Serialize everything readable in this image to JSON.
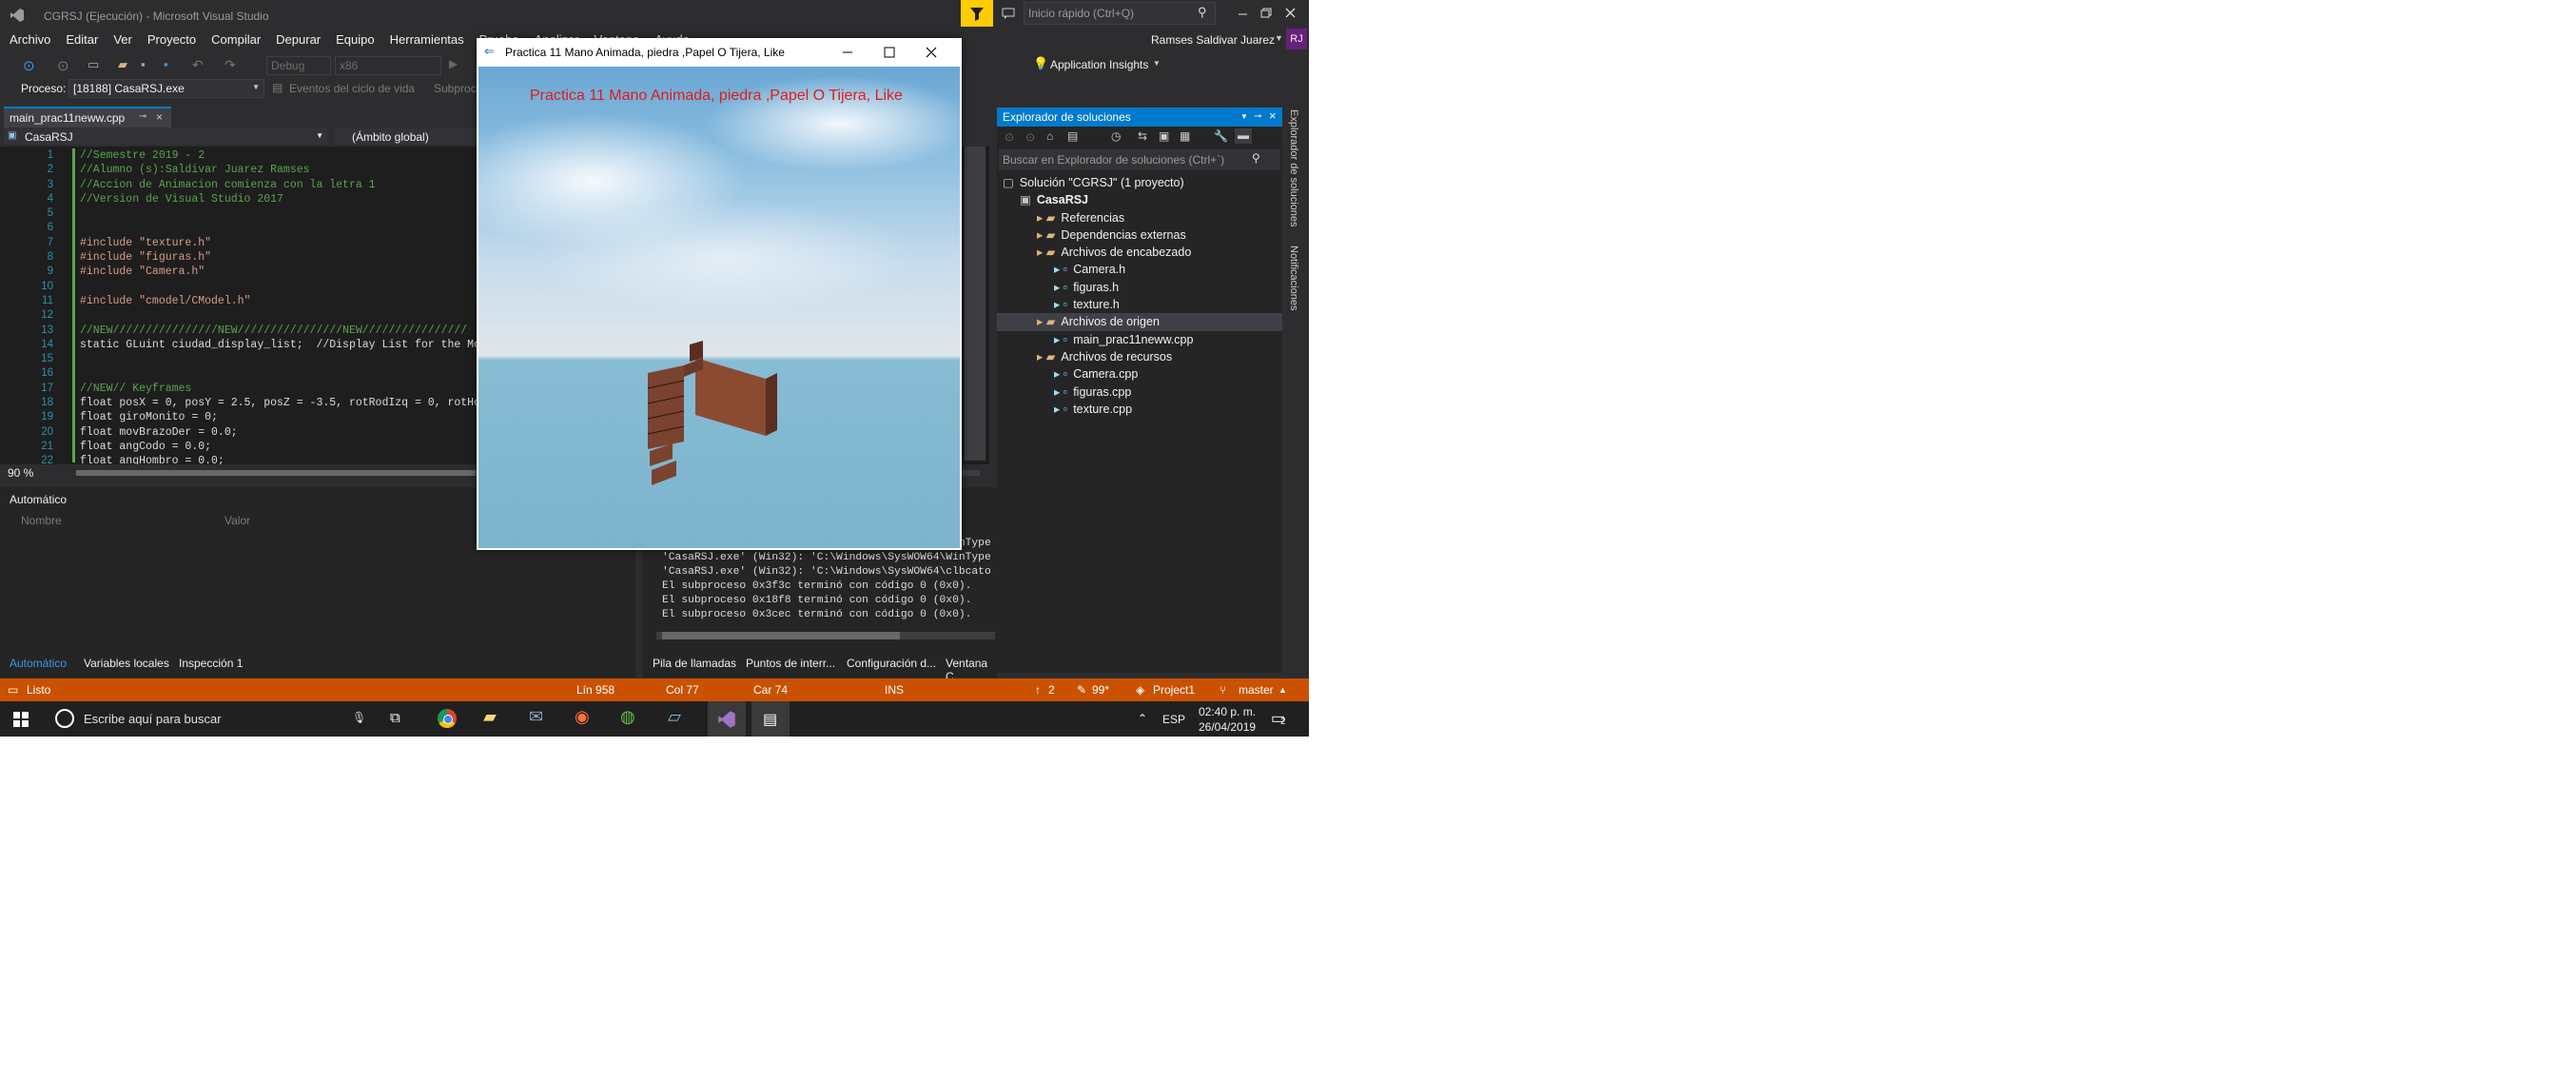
{
  "window": {
    "title": "CGRSJ (Ejecución) - Microsoft Visual Studio",
    "quick_launch": "Inicio rápido (Ctrl+Q)",
    "user": "Ramses Saldivar Juarez",
    "user_initials": "RJ"
  },
  "menu": [
    "Archivo",
    "Editar",
    "Ver",
    "Proyecto",
    "Compilar",
    "Depurar",
    "Equipo",
    "Herramientas",
    "Prueba",
    "Analizar",
    "Ventana",
    "Ayuda"
  ],
  "toolbar": {
    "config": "Debug",
    "platform": "x86",
    "app_insights": "Application Insights",
    "process_label": "Proceso:",
    "process_value": "[18188] CasaRSJ.exe",
    "lifecycle": "Eventos del ciclo de vida",
    "subprocess": "Subproceso:"
  },
  "editor": {
    "tab": "main_prac11neww.cpp",
    "scope_left": "CasaRSJ",
    "scope_right": "(Ámbito global)",
    "zoom": "90 %",
    "line_numbers": [
      "1",
      "2",
      "3",
      "4",
      "5",
      "6",
      "7",
      "8",
      "9",
      "10",
      "11",
      "12",
      "13",
      "14",
      "15",
      "16",
      "17",
      "18",
      "19",
      "20",
      "21",
      "22"
    ],
    "lines": [
      "//Semestre 2019 - 2",
      "//Alumno (s):Saldivar Juarez Ramses",
      "//Accion de Animacion comienza con la letra 1",
      "//Version de Visual Studio 2017",
      "",
      "",
      "#include \"texture.h\"",
      "#include \"figuras.h\"",
      "#include \"Camera.h\"",
      "",
      "#include \"cmodel/CModel.h\"",
      "",
      "//NEW////////////////NEW////////////////NEW////////////////",
      "static GLuint ciudad_display_list;  //Display List for the Moni",
      "",
      "",
      "//NEW// Keyframes",
      "float posX = 0, posY = 2.5, posZ = -3.5, rotRodIzq = 0, rotHomI",
      "float giroMonito = 0;",
      "float movBrazoDer = 0.0;",
      "float angCodo = 0.0;",
      "float angHombro = 0.0;"
    ]
  },
  "autos": {
    "title": "Automático",
    "col_name": "Nombre",
    "col_value": "Valor",
    "tabs": [
      "Automático",
      "Variables locales",
      "Inspección 1"
    ]
  },
  "output": {
    "lines": [
      "'CasaRSJ.exe' (Win32): 'C:\\Windows\\SysWOW64\\WinType",
      "'CasaRSJ.exe' (Win32): 'C:\\Windows\\SysWOW64\\WinType",
      "'CasaRSJ.exe' (Win32): 'C:\\Windows\\SysWOW64\\clbcato",
      "El subproceso 0x3f3c terminó con código 0 (0x0).",
      "El subproceso 0x18f8 terminó con código 0 (0x0).",
      "El subproceso 0x3cec terminó con código 0 (0x0)."
    ],
    "tabs": [
      "Pila de llamadas",
      "Puntos de interr...",
      "Configuración d...",
      "Ventana C"
    ]
  },
  "solution_explorer": {
    "title": "Explorador de soluciones",
    "search": "Buscar en Explorador de soluciones (Ctrl+`)",
    "side_tabs": [
      "Explorador de soluciones",
      "Notificaciones"
    ],
    "items": [
      {
        "label": "Solución \"CGRSJ\" (1 proyecto)",
        "indent": 0
      },
      {
        "label": "CasaRSJ",
        "indent": 1
      },
      {
        "label": "Referencias",
        "indent": 2
      },
      {
        "label": "Dependencias externas",
        "indent": 2
      },
      {
        "label": "Archivos de encabezado",
        "indent": 2
      },
      {
        "label": "Camera.h",
        "indent": 3
      },
      {
        "label": "figuras.h",
        "indent": 3
      },
      {
        "label": "texture.h",
        "indent": 3
      },
      {
        "label": "Archivos de origen",
        "indent": 2
      },
      {
        "label": "main_prac11neww.cpp",
        "indent": 3
      },
      {
        "label": "Archivos de recursos",
        "indent": 2
      },
      {
        "label": "Camera.cpp",
        "indent": 3
      },
      {
        "label": "figuras.cpp",
        "indent": 3
      },
      {
        "label": "texture.cpp",
        "indent": 3
      }
    ]
  },
  "statusbar": {
    "state": "Listo",
    "line": "Lín 958",
    "col": "Col 77",
    "char": "Car 74",
    "mode": "INS",
    "up_count": "2",
    "edits": "99*",
    "project": "Project1",
    "branch": "master"
  },
  "app": {
    "title": "Practica 11 Mano Animada, piedra ,Papel O Tijera, Like",
    "overlay_text": "Practica 11 Mano Animada, piedra ,Papel O Tijera, Like",
    "overlay_color": "#e21b1b"
  },
  "taskbar": {
    "search": "Escribe aquí para buscar",
    "lang": "ESP",
    "time": "02:40 p. m.",
    "date": "26/04/2019",
    "notif_count": "2"
  },
  "colors": {
    "accent": "#007acc",
    "status": "#ca5100",
    "vs_purple": "#68217a"
  }
}
